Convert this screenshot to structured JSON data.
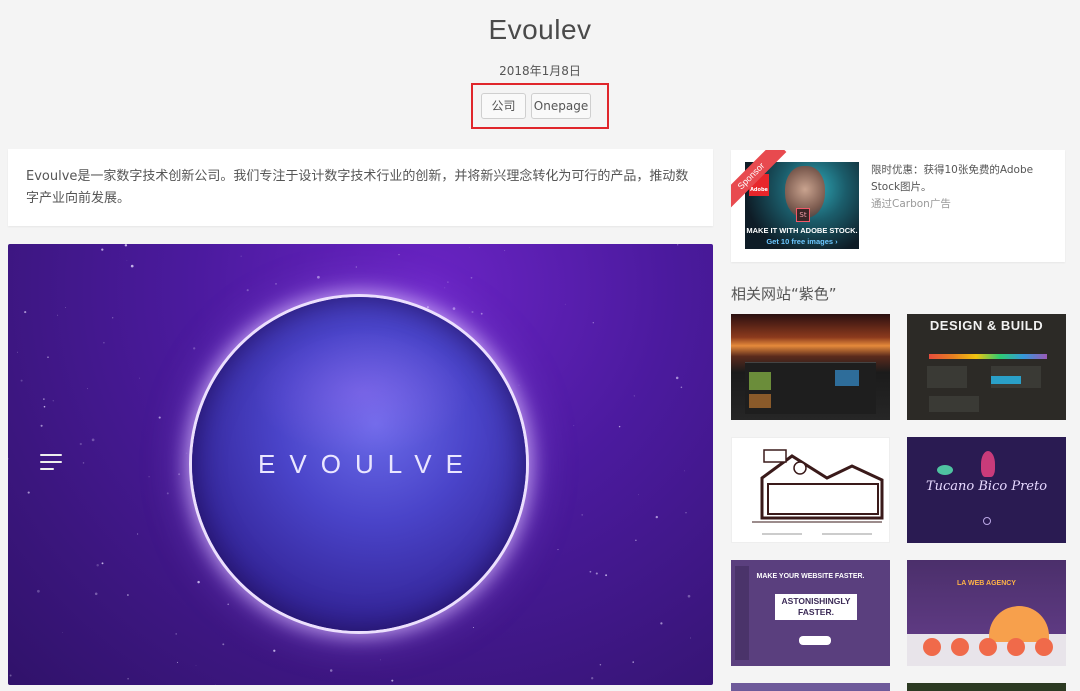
{
  "header": {
    "title": "Evoulev",
    "date": "2018年1月8日",
    "tags": [
      "公司",
      "Onepage"
    ]
  },
  "description": "Evoulve是一家数字技术创新公司。我们专注于设计数字技术行业的创新，并将新兴理念转化为可行的产品，推动数字产业向前发展。",
  "hero": {
    "logo_text": "EVOULVE"
  },
  "sponsor": {
    "ribbon": "Sponsor",
    "ad_brand": "Adobe",
    "ad_badge": "St",
    "ad_line1": "MAKE IT WITH ADOBE STOCK.",
    "ad_line2": "Get 10 free images ›",
    "text": "限时优惠：获得10张免费的Adobe Stock图片。",
    "via": "通过Carbon广告"
  },
  "related": {
    "title": "相关网站“紫色”",
    "thumbs": [
      {
        "label": ""
      },
      {
        "label": "DESIGN & BUILD"
      },
      {
        "label": ""
      },
      {
        "label": "Tucano Bico Preto"
      },
      {
        "label": "ASTONISHINGLY FASTER.",
        "sub": "MAKE YOUR WEBSITE FASTER."
      },
      {
        "label": "LA WEB AGENCY"
      }
    ]
  },
  "colors": {
    "highlight": "#e0262b",
    "hero_bg": "#3b167e",
    "ribbon": "#e84a4f"
  }
}
